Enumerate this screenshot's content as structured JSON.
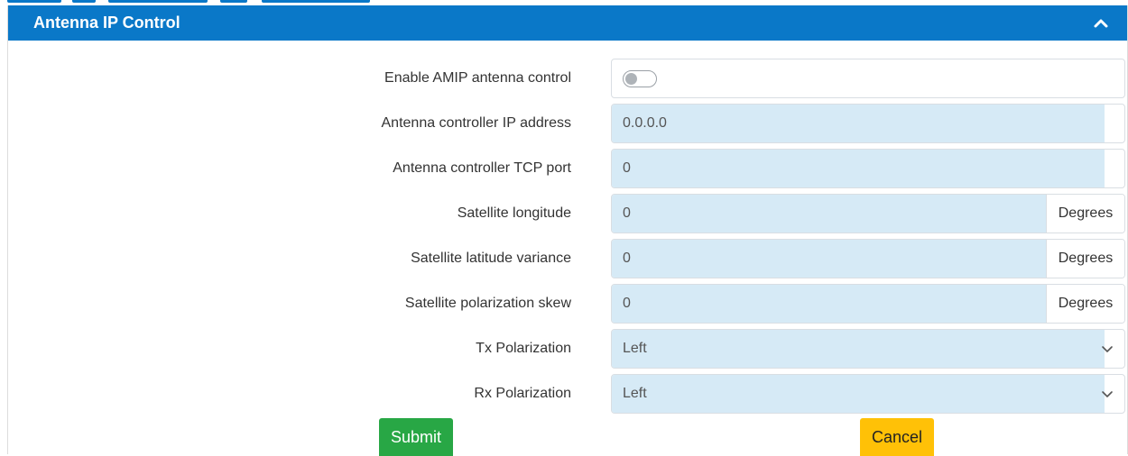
{
  "panel": {
    "title": "Antenna IP Control",
    "header_color": "#0a78c8",
    "collapse_icon": "chevron-up-icon"
  },
  "fields": {
    "amip": {
      "label": "Enable AMIP antenna control",
      "enabled": false
    },
    "ip_address": {
      "label": "Antenna controller IP address",
      "value": "0.0.0.0"
    },
    "tcp_port": {
      "label": "Antenna controller TCP port",
      "value": "0"
    },
    "sat_longitude": {
      "label": "Satellite longitude",
      "value": "0",
      "unit": "Degrees"
    },
    "sat_lat_variance": {
      "label": "Satellite latitude variance",
      "value": "0",
      "unit": "Degrees"
    },
    "sat_pol_skew": {
      "label": "Satellite polarization skew",
      "value": "0",
      "unit": "Degrees"
    },
    "tx_polarization": {
      "label": "Tx Polarization",
      "value": "Left"
    },
    "rx_polarization": {
      "label": "Rx Polarization",
      "value": "Left"
    }
  },
  "buttons": {
    "submit": "Submit",
    "cancel": "Cancel",
    "submit_color": "#28a745",
    "cancel_color": "#ffc107"
  }
}
